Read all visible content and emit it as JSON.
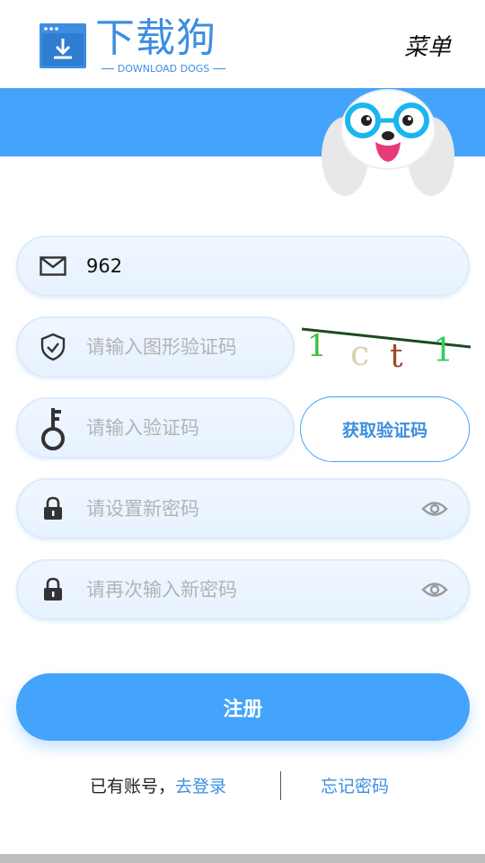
{
  "header": {
    "logo_title": "下载狗",
    "logo_subtitle": "DOWNLOAD DOGS",
    "menu_label": "菜单"
  },
  "form": {
    "email": {
      "value": "962",
      "icon": "mail-icon"
    },
    "captcha": {
      "placeholder": "请输入图形验证码",
      "icon": "shield-check-icon",
      "image_text": "1ct1"
    },
    "code": {
      "placeholder": "请输入验证码",
      "icon": "key-icon",
      "button_label": "获取验证码"
    },
    "password": {
      "placeholder": "请设置新密码",
      "icon": "lock-icon"
    },
    "password_confirm": {
      "placeholder": "请再次输入新密码",
      "icon": "lock-icon"
    },
    "register_label": "注册"
  },
  "footer": {
    "have_account": "已有账号，",
    "login_link": "去登录",
    "forgot_link": "忘记密码"
  },
  "colors": {
    "accent": "#44a3fb",
    "link": "#3d8ee0",
    "field_bg": "#eaf4ff",
    "placeholder": "#b3b3b3"
  }
}
